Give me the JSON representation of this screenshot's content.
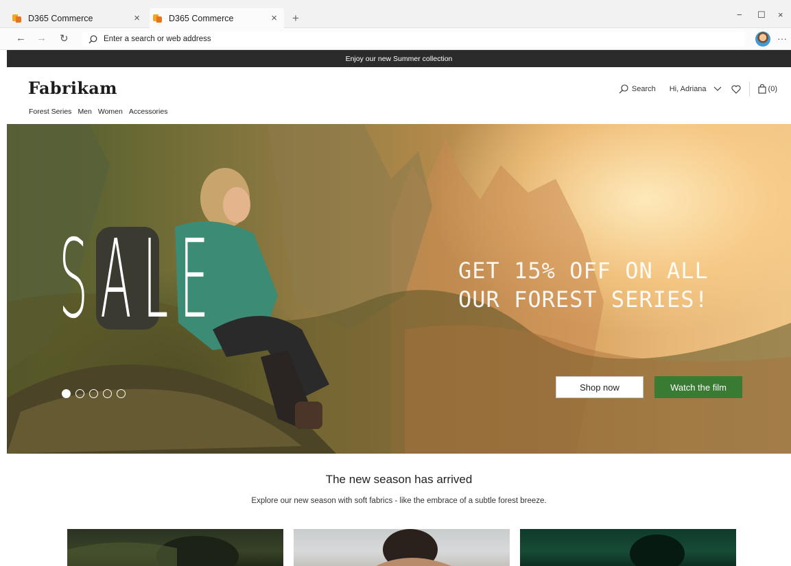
{
  "browser": {
    "tabs": [
      {
        "title": "D365 Commerce",
        "close": "×"
      },
      {
        "title": "D365 Commerce",
        "close": "×"
      }
    ],
    "new_tab": "+",
    "window_controls": {
      "minimize": "−",
      "maximize": "☐",
      "close": "×"
    },
    "nav": {
      "back": "←",
      "forward": "→",
      "refresh": "↻"
    },
    "address_placeholder": "Enter a search or web address",
    "more": "···"
  },
  "promo": {
    "text": "Enjoy our new Summer collection"
  },
  "header": {
    "logo": "Fabrikam",
    "nav": [
      "Forest Series",
      "Men",
      "Women",
      "Accessories"
    ],
    "search_label": "Search",
    "greeting": "Hi, Adriana",
    "cart_label": "(0)"
  },
  "hero": {
    "sale_text": "SALE",
    "headline_line1": "GET 15% OFF ON ALL",
    "headline_line2": "OUR FOREST SERIES!",
    "shop_now": "Shop now",
    "watch_film": "Watch the film",
    "slide_count": 5,
    "active_slide": 1
  },
  "section": {
    "title": "The new season has arrived",
    "subtitle": "Explore our new season with soft fabrics - like the embrace of a subtle forest breeze."
  },
  "colors": {
    "promo_bg": "#2b2b2b",
    "accent_green": "#3a7b33",
    "favicon_orange": "#f5a623"
  },
  "icons": [
    "favicon-icon",
    "close-icon",
    "plus-icon",
    "back-icon",
    "forward-icon",
    "refresh-icon",
    "search-icon",
    "profile-icon",
    "more-icon",
    "chevron-down-icon",
    "heart-icon",
    "shopping-bag-icon"
  ]
}
